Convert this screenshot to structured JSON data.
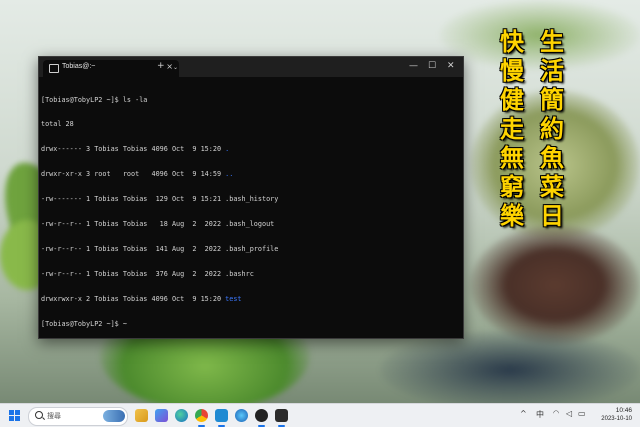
{
  "wallpaper": {
    "poem_right": [
      "生",
      "活",
      "簡",
      "約",
      "魚",
      "菜",
      "日"
    ],
    "poem_left": [
      "快",
      "慢",
      "健",
      "走",
      "無",
      "窮",
      "樂"
    ],
    "poem_color": "#ffd400"
  },
  "terminal": {
    "tab_title": "Tobias@:~",
    "tab_close": "×",
    "new_tab": "+",
    "dropdown": "⌄",
    "minimize": "—",
    "maximize": "☐",
    "close": "✕",
    "lines": [
      {
        "text": "[Tobias@TobyLP2 ~]$ ls -la",
        "name_suffix": ""
      },
      {
        "text": "total 28"
      },
      {
        "text": "drwx------ 3 Tobias Tobias 4096 Oct  9 15:20 ",
        "name": "."
      },
      {
        "text": "drwxr-xr-x 3 root   root   4096 Oct  9 14:59 ",
        "name": ".."
      },
      {
        "text": "-rw------- 1 Tobias Tobias  129 Oct  9 15:21 .bash_history"
      },
      {
        "text": "-rw-r--r-- 1 Tobias Tobias   18 Aug  2  2022 .bash_logout"
      },
      {
        "text": "-rw-r--r-- 1 Tobias Tobias  141 Aug  2  2022 .bash_profile"
      },
      {
        "text": "-rw-r--r-- 1 Tobias Tobias  376 Aug  2  2022 .bashrc"
      },
      {
        "text": "drwxrwxr-x 2 Tobias Tobias 4096 Oct  9 15:20 ",
        "name": "test"
      },
      {
        "text": "[Tobias@TobyLP2 ~]$ ~"
      }
    ],
    "dir_color": "#3b78ff"
  },
  "taskbar": {
    "search_placeholder": "搜尋",
    "icons": [
      "file-explorer-icon",
      "photos-icon",
      "edge-icon",
      "chrome-icon",
      "vscode-icon",
      "browser-icon",
      "media-player-icon",
      "terminal-icon"
    ],
    "tray": {
      "chevron": "^",
      "lang": "中",
      "wifi": "wifi-icon",
      "volume": "volume-icon",
      "battery": "battery-icon"
    },
    "time": "10:46",
    "date": "2023-10-10"
  }
}
